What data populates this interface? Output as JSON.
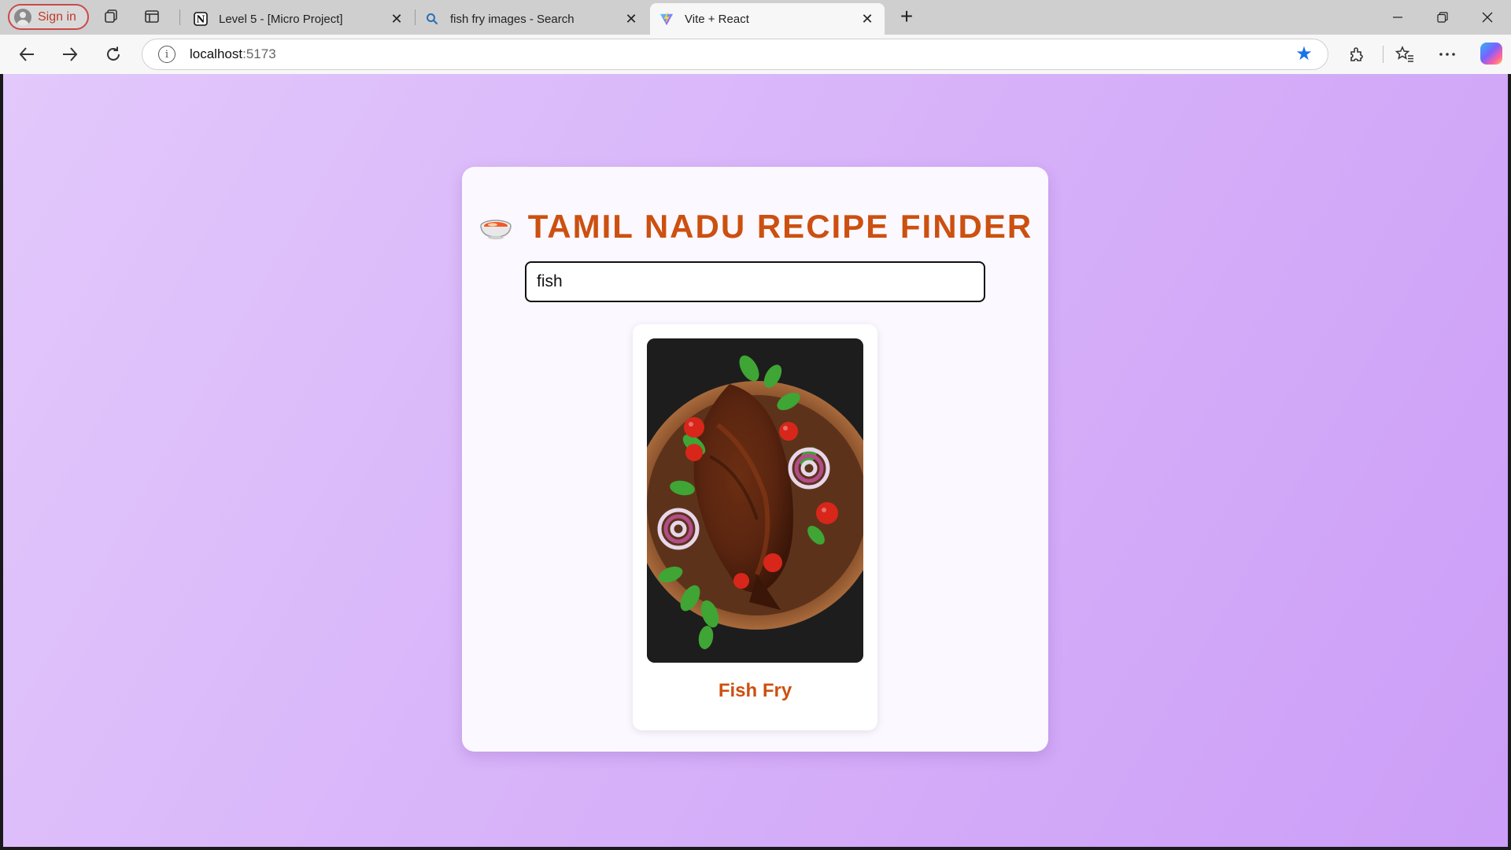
{
  "browser": {
    "profile": {
      "label": "Sign in",
      "icon": "profile-avatar-icon"
    },
    "tabs": [
      {
        "title": "Level 5 - [Micro Project]",
        "icon": "notion-icon",
        "active": false
      },
      {
        "title": "fish fry images - Search",
        "icon": "search-icon",
        "active": false
      },
      {
        "title": "Vite + React",
        "icon": "vite-icon",
        "active": true
      }
    ],
    "address": {
      "host": "localhost",
      "port": ":5173"
    },
    "accent_color": "#1a73e8"
  },
  "page": {
    "heading": "TAMIL NADU RECIPE FINDER",
    "heading_icon": "bowl-emoji-icon",
    "search": {
      "value": "fish"
    },
    "results": [
      {
        "title": "Fish Fry",
        "image": "fish-fry-photo"
      }
    ],
    "colors": {
      "heading": "#cc5010",
      "background_start": "#e2c8fb",
      "background_end": "#cc9ef7"
    }
  }
}
